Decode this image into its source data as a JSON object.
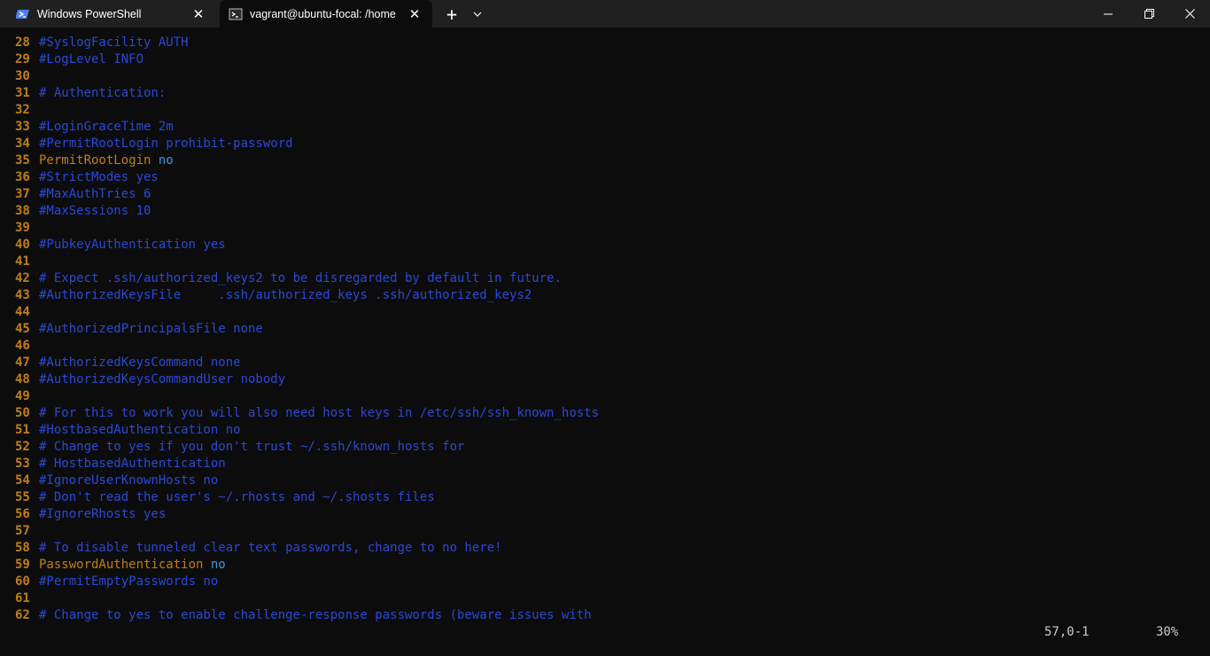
{
  "tabs": [
    {
      "label": "Windows PowerShell",
      "icon": "powershell-icon"
    },
    {
      "label": "vagrant@ubuntu-focal: /home",
      "icon": "terminal-icon"
    }
  ],
  "window_controls": {
    "new_tab": "+",
    "dropdown": "chevron-down-icon"
  },
  "colors": {
    "background": "#0c0c0c",
    "line_number": "#c07f14",
    "comment": "#2a49d6",
    "keyword": "#c07f14",
    "value": "#3a96dd"
  },
  "editor": {
    "lines": [
      {
        "n": "28",
        "text": "#SyslogFacility AUTH",
        "type": "comment"
      },
      {
        "n": "29",
        "text": "#LogLevel INFO",
        "type": "comment"
      },
      {
        "n": "30",
        "text": "",
        "type": "empty"
      },
      {
        "n": "31",
        "text": "# Authentication:",
        "type": "comment"
      },
      {
        "n": "32",
        "text": "",
        "type": "empty"
      },
      {
        "n": "33",
        "text": "#LoginGraceTime 2m",
        "type": "comment"
      },
      {
        "n": "34",
        "text": "#PermitRootLogin prohibit-password",
        "type": "comment"
      },
      {
        "n": "35",
        "key": "PermitRootLogin",
        "value": "no",
        "type": "setting"
      },
      {
        "n": "36",
        "text": "#StrictModes yes",
        "type": "comment"
      },
      {
        "n": "37",
        "text": "#MaxAuthTries 6",
        "type": "comment"
      },
      {
        "n": "38",
        "text": "#MaxSessions 10",
        "type": "comment"
      },
      {
        "n": "39",
        "text": "",
        "type": "empty"
      },
      {
        "n": "40",
        "text": "#PubkeyAuthentication yes",
        "type": "comment"
      },
      {
        "n": "41",
        "text": "",
        "type": "empty"
      },
      {
        "n": "42",
        "text": "# Expect .ssh/authorized_keys2 to be disregarded by default in future.",
        "type": "comment"
      },
      {
        "n": "43",
        "text": "#AuthorizedKeysFile     .ssh/authorized_keys .ssh/authorized_keys2",
        "type": "comment"
      },
      {
        "n": "44",
        "text": "",
        "type": "empty"
      },
      {
        "n": "45",
        "text": "#AuthorizedPrincipalsFile none",
        "type": "comment"
      },
      {
        "n": "46",
        "text": "",
        "type": "empty"
      },
      {
        "n": "47",
        "text": "#AuthorizedKeysCommand none",
        "type": "comment"
      },
      {
        "n": "48",
        "text": "#AuthorizedKeysCommandUser nobody",
        "type": "comment"
      },
      {
        "n": "49",
        "text": "",
        "type": "empty"
      },
      {
        "n": "50",
        "text": "# For this to work you will also need host keys in /etc/ssh/ssh_known_hosts",
        "type": "comment"
      },
      {
        "n": "51",
        "text": "#HostbasedAuthentication no",
        "type": "comment"
      },
      {
        "n": "52",
        "text": "# Change to yes if you don't trust ~/.ssh/known_hosts for",
        "type": "comment"
      },
      {
        "n": "53",
        "text": "# HostbasedAuthentication",
        "type": "comment"
      },
      {
        "n": "54",
        "text": "#IgnoreUserKnownHosts no",
        "type": "comment"
      },
      {
        "n": "55",
        "text": "# Don't read the user's ~/.rhosts and ~/.shosts files",
        "type": "comment"
      },
      {
        "n": "56",
        "text": "#IgnoreRhosts yes",
        "type": "comment"
      },
      {
        "n": "57",
        "text": "",
        "type": "empty"
      },
      {
        "n": "58",
        "text": "# To disable tunneled clear text passwords, change to no here!",
        "type": "comment"
      },
      {
        "n": "59",
        "key": "PasswordAuthentication",
        "value": "no",
        "type": "setting"
      },
      {
        "n": "60",
        "text": "#PermitEmptyPasswords no",
        "type": "comment"
      },
      {
        "n": "61",
        "text": "",
        "type": "empty"
      },
      {
        "n": "62",
        "text": "# Change to yes to enable challenge-response passwords (beware issues with",
        "type": "comment"
      }
    ]
  },
  "status": {
    "position": "57,0-1",
    "percent": "30%"
  }
}
